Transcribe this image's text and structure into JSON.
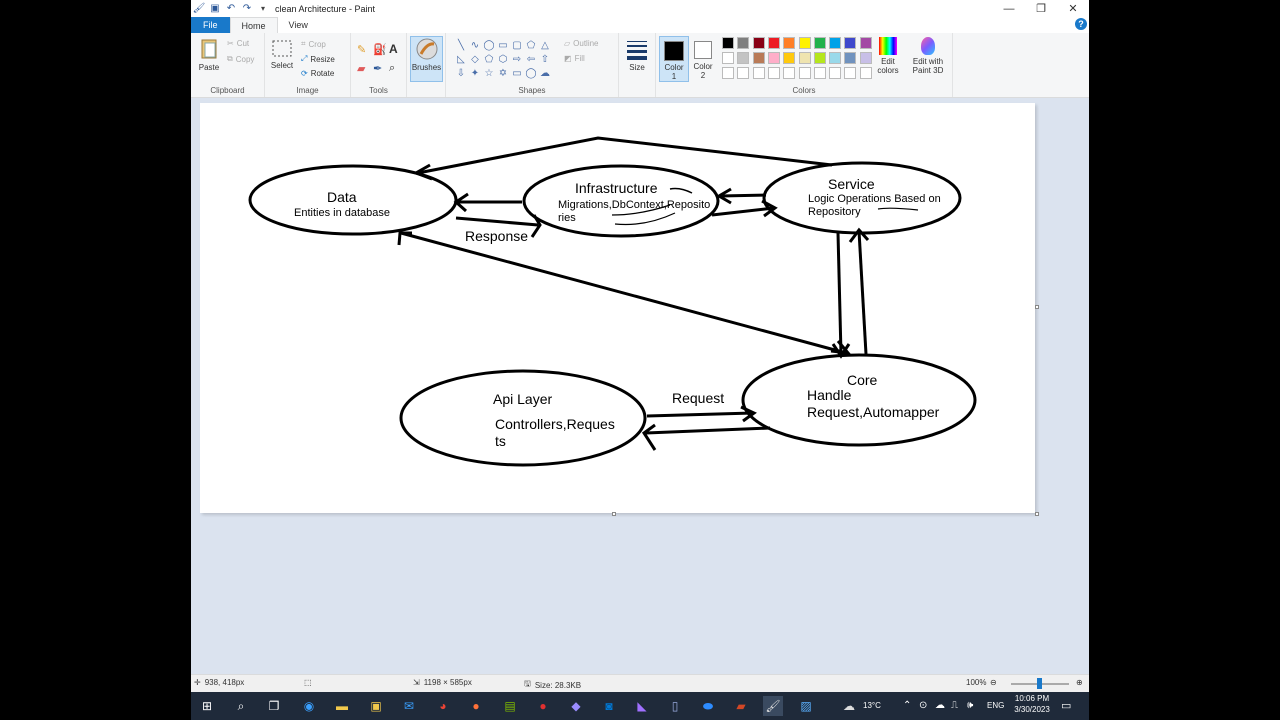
{
  "window": {
    "title": "clean Architecture - Paint",
    "controls": [
      "—",
      "❐",
      "✕"
    ]
  },
  "tabs": [
    "File",
    "Home",
    "View"
  ],
  "ribbon": {
    "clipboard": {
      "label": "Clipboard",
      "paste": "Paste",
      "cut": "Cut",
      "copy": "Copy"
    },
    "image": {
      "label": "Image",
      "select": "Select",
      "crop": "Crop",
      "resize": "Resize",
      "rotate": "Rotate"
    },
    "tools": {
      "label": "Tools"
    },
    "brushes": {
      "label": "Brushes"
    },
    "shapes": {
      "label": "Shapes",
      "outline": "Outline",
      "fill": "Fill"
    },
    "size": {
      "label": "Size"
    },
    "colors": {
      "label": "Colors",
      "color1": "Color 1",
      "color2": "Color 2",
      "edit": "Edit colors",
      "paint3d": "Edit with Paint 3D",
      "palette_row1": [
        "#000000",
        "#7f7f7f",
        "#880015",
        "#ed1c24",
        "#ff7f27",
        "#fff200",
        "#22b14c",
        "#00a2e8",
        "#3f48cc",
        "#a349a4"
      ],
      "palette_row2": [
        "#ffffff",
        "#c3c3c3",
        "#b97a57",
        "#ffaec9",
        "#ffc90e",
        "#efe4b0",
        "#b5e61d",
        "#99d9ea",
        "#7092be",
        "#c8bfe7"
      ]
    }
  },
  "diagram": {
    "data": {
      "title": "Data",
      "desc": "Entities in database"
    },
    "infrastructure": {
      "title": "Infrastructure",
      "desc1": "Migrations,DbContext,Reposito",
      "desc2": "ries"
    },
    "service": {
      "title": "Service",
      "desc1": "Logic Operations Based on",
      "desc2": "Repository"
    },
    "core": {
      "title": "Core",
      "desc1": "Handle",
      "desc2": "Request,Automapper"
    },
    "api": {
      "title": "Api Layer",
      "desc1": "Controllers,Reques",
      "desc2": "ts"
    },
    "response_label": "Response",
    "request_label": "Request"
  },
  "status": {
    "cursor": "938, 418px",
    "dimensions": "1198 × 585px",
    "size": "Size: 28.3KB",
    "zoom": "100%"
  },
  "taskbar": {
    "weather": "13°C",
    "lang": "ENG",
    "time": "10:06 PM",
    "date": "3/30/2023"
  }
}
